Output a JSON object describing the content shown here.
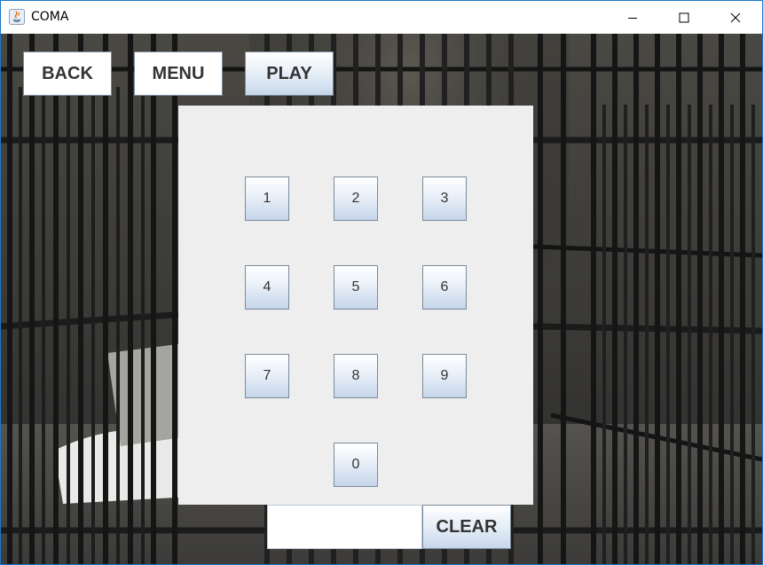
{
  "window": {
    "title": "COMA",
    "controls": {
      "minimize_icon": "minimize-icon",
      "maximize_icon": "maximize-icon",
      "close_icon": "close-icon"
    }
  },
  "nav": {
    "back_label": "BACK",
    "menu_label": "MENU",
    "play_label": "PLAY"
  },
  "keypad": {
    "keys": [
      "1",
      "2",
      "3",
      "4",
      "5",
      "6",
      "7",
      "8",
      "9",
      "0"
    ]
  },
  "code_input": {
    "value": "",
    "placeholder": ""
  },
  "clear_label": "CLEAR",
  "colors": {
    "button_gradient_top": "#ffffff",
    "button_gradient_bottom": "#c7d7ea",
    "panel": "#eeeeee",
    "window_border": "#1979ca"
  }
}
